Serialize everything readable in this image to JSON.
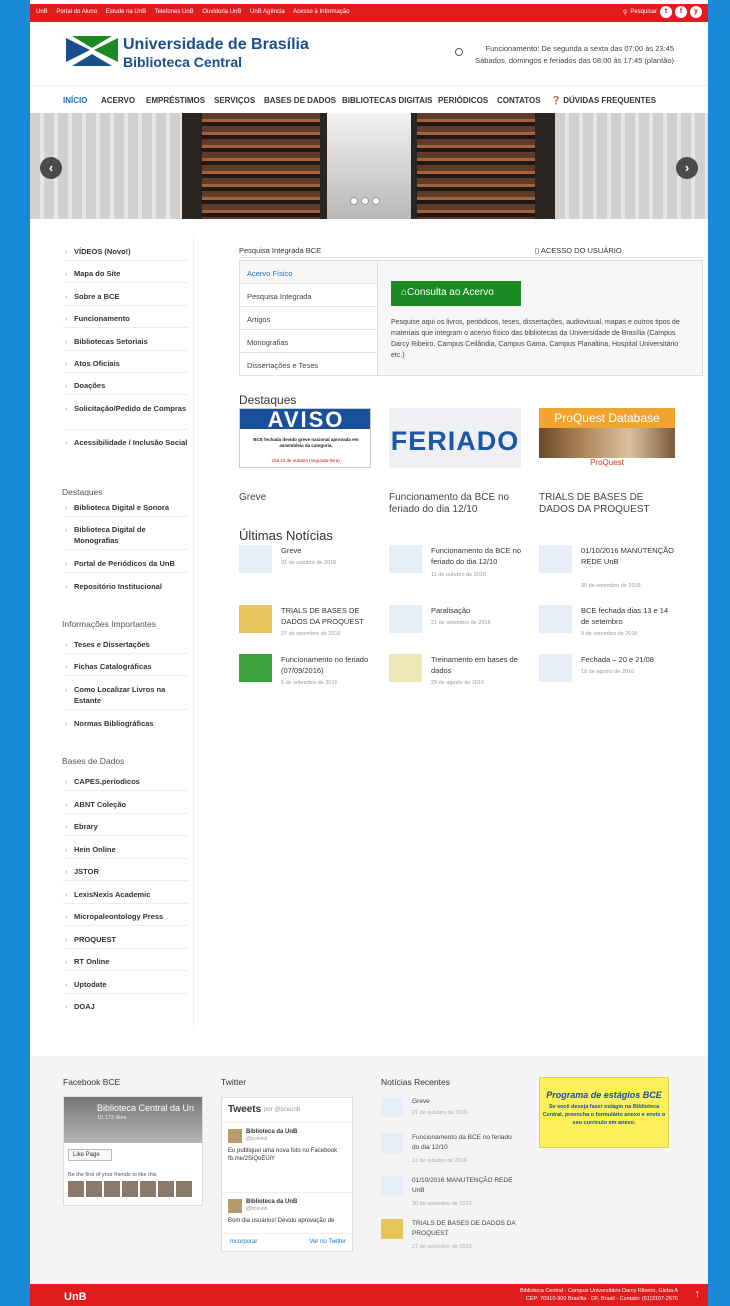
{
  "topbar": {
    "links": [
      "UnB",
      "Portal do Aluno",
      "Estude na UnB",
      "Telefones UnB",
      "Ouvidoria UnB",
      "UnB Agência",
      "Acesso à Informação"
    ],
    "search_label": "Pesquisar",
    "social": [
      "t",
      "f",
      "y"
    ]
  },
  "header": {
    "title": "Universidade de Brasília",
    "subtitle": "Biblioteca Central",
    "hours_line1": "Funcionamento: De segunda a sexta das 07:00 às 23:45",
    "hours_line2": "Sábados, domingos e feriados das 08:00 às 17:45 (plantão)"
  },
  "nav": {
    "items": [
      "INÍCIO",
      "ACERVO",
      "EMPRÉSTIMOS",
      "SERVIÇOS",
      "BASES DE DADOS",
      "BIBLIOTECAS DIGITAIS",
      "PERIÓDICOS",
      "CONTATOS",
      "DÚVIDAS FREQUENTES"
    ]
  },
  "banner": {
    "prev": "‹",
    "next": "›"
  },
  "sidebar": {
    "main_items": [
      "VÍDEOS (Novo!)",
      "Mapa do Site",
      "Sobre a BCE",
      "Funcionamento",
      "Bibliotecas Setoriais",
      "Atos Oficiais",
      "Doações",
      "Solicitação/Pedido de Compras",
      "Acessibilidade / Inclusão Social"
    ],
    "destaques_title": "Destaques",
    "destaques_items": [
      "Biblioteca Digital e Sonora",
      "Biblioteca Digital de Monografias",
      "Portal de Periódicos da UnB",
      "Repositório Institucional"
    ],
    "info_title": "Informações Importantes",
    "info_items": [
      "Teses e Dissertações",
      "Fichas Catalográficas",
      "Como Localizar Livros na Estante",
      "Normas Bibliográficas"
    ],
    "bases_title": "Bases de Dados",
    "bases_items": [
      "CAPES.periodicos",
      "ABNT Coleção",
      "Ebrary",
      "Hein Online",
      "JSTOR",
      "LexisNexis Academic",
      "Micropaleontology Press",
      "PROQUEST",
      "RT Online",
      "Uptodate",
      "DOAJ"
    ]
  },
  "search": {
    "title": "Pesquisa Integrada BCE",
    "access_label": "ACESSO DO USUÁRIO",
    "tabs": [
      "Acervo Físico",
      "Pesquisa Integrada",
      "Artigos",
      "Monografias",
      "Dissertações e Teses"
    ],
    "button": "Consulta ao Acervo",
    "description": "Pesquise aqui os livros, periódicos, teses, dissertações, audiovisual, mapas e outros tipos de materiais que integram o acervo físico das bibliotecas da Universidade de Brasília (Campus Darcy Ribeiro, Campus Ceilândia, Campus Gama, Campus Planaltina, Hospital Universitário etc.)"
  },
  "destaques": {
    "title": "Destaques",
    "aviso_head": "AVISO",
    "aviso_sub": "BCE fechada devido greve nacional aprovada em assembleia da categoria.",
    "aviso_red": "Dia 24 de outubro (segunda-feira)",
    "feriado_text": "FERIADO",
    "proquest_head": "ProQuest Database",
    "proquest_logo": "ProQuest",
    "captions": [
      "Greve",
      "Funcionamento da BCE no feriado do dia 12/10",
      "TRIALS DE BASES DE DADOS DA PROQUEST"
    ]
  },
  "news": {
    "title": "Últimas Notícias",
    "items": [
      {
        "title": "Greve",
        "date": "21 de outubro de 2016"
      },
      {
        "title": "Funcionamento da BCE no feriado do dia 12/10",
        "date": "11 de outubro de 2016"
      },
      {
        "title": "01/10/2016 MANUTENÇÃO REDE UnB",
        "date": "30 de setembro de 2016"
      },
      {
        "title": "TRIALS DE BASES DE DADOS DA PROQUEST",
        "date": "27 de setembro de 2016"
      },
      {
        "title": "Paralisação",
        "date": "21 de setembro de 2016"
      },
      {
        "title": "BCE fechada dias 13 e 14 de setembro",
        "date": "9 de setembro de 2016"
      },
      {
        "title": "Funcionamento no feriado (07/09/2016)",
        "date": "6 de setembro de 2016"
      },
      {
        "title": "Treinamento em bases de dados",
        "date": "29 de agosto de 2016"
      },
      {
        "title": "Fechada – 20 e 21/08",
        "date": "18 de agosto de 2016"
      }
    ]
  },
  "footer": {
    "facebook_title": "Facebook BCE",
    "fb_page_name": "Biblioteca Central da Un",
    "fb_likes": "10.173 likes",
    "fb_like_button": "Like Page",
    "fb_friends": "Be the first of your friends to like this",
    "twitter_title": "Twitter",
    "tweets_label": "Tweets",
    "tweets_by": "por @bceunb",
    "tweets": [
      {
        "name": "Biblioteca da UnB",
        "handle": "@bceunb",
        "text": "Eu publiquei uma nova foto no Facebook fb.me/2SiQoEUiY"
      },
      {
        "name": "Biblioteca da UnB",
        "handle": "@bceunb",
        "text": "Bom dia usuários! Devido aprovação de"
      }
    ],
    "tw_embed": "Incorporar",
    "tw_view": "Ver no Twitter",
    "recent_title": "Notícias Recentes",
    "recent": [
      {
        "title": "Greve",
        "date": "21 de outubro de 2016"
      },
      {
        "title": "Funcionamento da BCE no feriado do dia 12/10",
        "date": "11 de outubro de 2016"
      },
      {
        "title": "01/10/2016 MANUTENÇÃO REDE UnB",
        "date": "30 de setembro de 2016"
      },
      {
        "title": "TRIALS DE BASES DE DADOS DA PROQUEST",
        "date": "27 de setembro de 2016"
      }
    ],
    "estagio_title": "Programa de estágios BCE",
    "estagio_text": "Se você deseja fazer estágio na Biblioteca Central, preencha o formulário anexo e envie o seu currículo em anexo."
  },
  "bottombar": {
    "logo": "UnB",
    "line1": "Biblioteca Central - Campus Universitário Darcy Ribeiro, Gleba A",
    "line2": "CEP: 70910-900 Brasília - DF, Brasil - Contato: (61)3107-2676",
    "up": "↑"
  },
  "colors": {
    "red": "#e01c1c",
    "blue": "#1a4f8b",
    "link": "#1e73b8",
    "green": "#1b8a25",
    "frame": "#1a8ad8"
  }
}
